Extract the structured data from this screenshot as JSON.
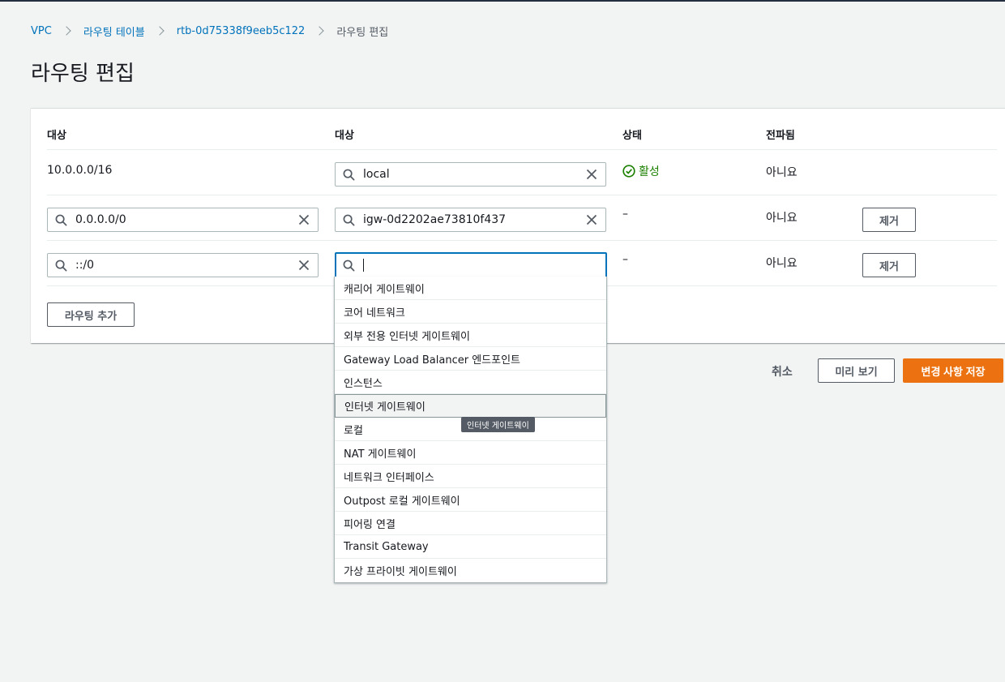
{
  "breadcrumb": {
    "items": [
      "VPC",
      "라우팅 테이블",
      "rtb-0d75338f9eeb5c122"
    ],
    "current": "라우팅 편집"
  },
  "page_title": "라우팅 편집",
  "table": {
    "headers": [
      "대상",
      "대상",
      "상태",
      "전파됨"
    ],
    "rows": [
      {
        "destination": "10.0.0.0/16",
        "target": "local",
        "status": "활성",
        "propagated": "아니요"
      },
      {
        "destination": "0.0.0.0/0",
        "target": "igw-0d2202ae73810f437",
        "status": "–",
        "propagated": "아니요",
        "remove_label": "제거"
      },
      {
        "destination": "::/0",
        "target": "",
        "status": "–",
        "propagated": "아니요",
        "remove_label": "제거"
      }
    ],
    "add_route_label": "라우팅 추가"
  },
  "dropdown": {
    "options": [
      "캐리어 게이트웨이",
      "코어 네트워크",
      "외부 전용 인터넷 게이트웨이",
      "Gateway Load Balancer 엔드포인트",
      "인스턴스",
      "인터넷 게이트웨이",
      "로컬",
      "NAT 게이트웨이",
      "네트워크 인터페이스",
      "Outpost 로컬 게이트웨이",
      "피어링 연결",
      "Transit Gateway",
      "가상 프라이빗 게이트웨이"
    ],
    "hovered_option": "인터넷 게이트웨이",
    "tooltip": "인터넷 게이트웨이"
  },
  "footer": {
    "cancel_label": "취소",
    "preview_label": "미리 보기",
    "save_label": "변경 사항 저장"
  },
  "colors": {
    "link": "#0073bb",
    "primary": "#ec7211",
    "success": "#1d8102",
    "focus": "#0073bb"
  },
  "icons": {
    "search": "search-icon",
    "clear": "close-icon",
    "status": "check-circle-icon",
    "breadcrumb_separator": "chevron-right-icon"
  }
}
